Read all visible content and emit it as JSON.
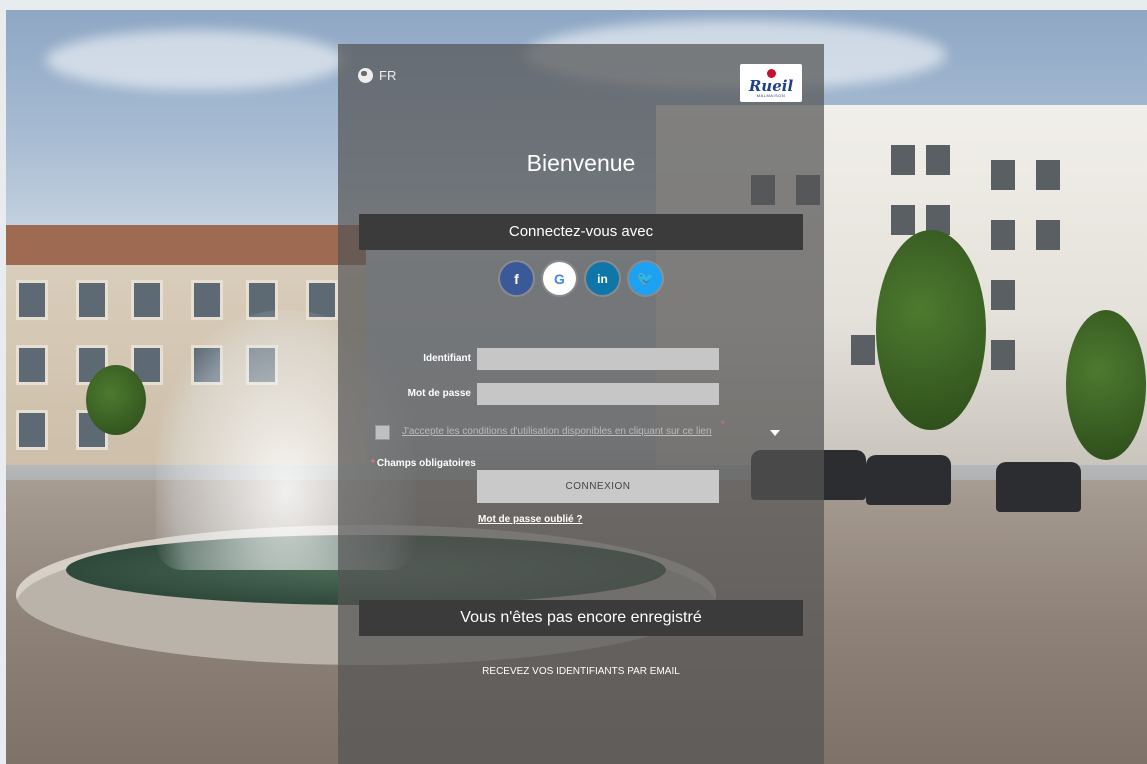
{
  "language": {
    "code": "FR"
  },
  "logo": {
    "text": "Rueil",
    "subtext": "MALMAISON"
  },
  "page": {
    "title": "Bienvenue"
  },
  "login": {
    "social_header": "Connectez-vous avec",
    "social": [
      {
        "label": "f",
        "icon": "facebook-icon"
      },
      {
        "label": "G",
        "icon": "google-icon"
      },
      {
        "label": "in",
        "icon": "linkedin-icon"
      },
      {
        "label": "🐦",
        "icon": "twitter-icon"
      }
    ],
    "identifier_label": "Identifiant",
    "identifier_value": "",
    "password_label": "Mot de passe",
    "password_value": "",
    "terms_text": "J'accepte les conditions d'utilisation disponibles en cliquant sur ce lien",
    "terms_required_mark": "*",
    "required_star": "*",
    "required_text": "Champs obligatoires",
    "submit_label": "CONNEXION",
    "forgot_label": "Mot de passe oublié ?"
  },
  "register": {
    "header": "Vous n'êtes pas encore enregistré",
    "email_link": "RECEVEZ VOS IDENTIFIANTS PAR EMAIL"
  },
  "colors": {
    "panel": "#555555",
    "band": "#3b3b3b",
    "facebook": "#3b5998",
    "linkedin": "#0e76a8",
    "twitter": "#1da1f2"
  }
}
